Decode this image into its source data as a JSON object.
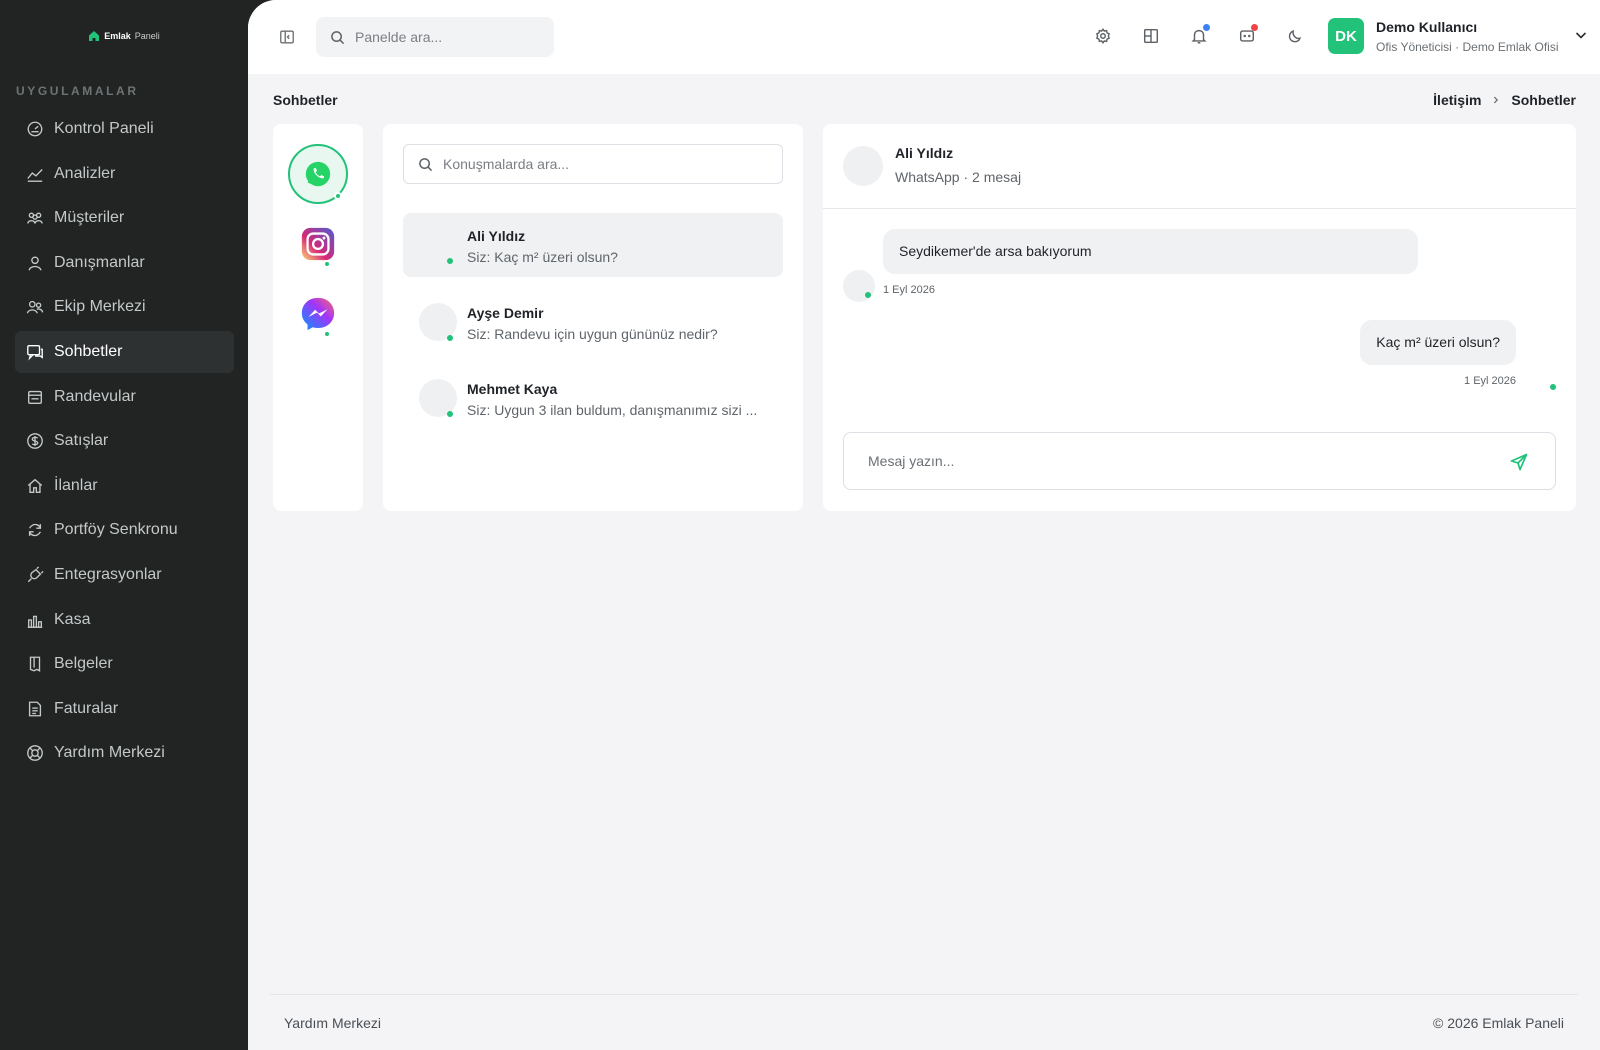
{
  "brand": {
    "name": "Emlak",
    "suffix": "Paneli"
  },
  "sidebar": {
    "section_label": "UYGULAMALAR",
    "items": [
      {
        "label": "Kontrol Paneli",
        "icon": "dashboard-icon"
      },
      {
        "label": "Analizler",
        "icon": "analytics-icon"
      },
      {
        "label": "Müşteriler",
        "icon": "customers-icon"
      },
      {
        "label": "Danışmanlar",
        "icon": "user-icon"
      },
      {
        "label": "Ekip Merkezi",
        "icon": "team-icon"
      },
      {
        "label": "Sohbetler",
        "icon": "chat-icon",
        "active": true
      },
      {
        "label": "Randevular",
        "icon": "calendar-icon"
      },
      {
        "label": "Satışlar",
        "icon": "dollar-icon"
      },
      {
        "label": "İlanlar",
        "icon": "home-icon"
      },
      {
        "label": "Portföy Senkronu",
        "icon": "sync-icon"
      },
      {
        "label": "Entegrasyonlar",
        "icon": "plug-icon"
      },
      {
        "label": "Kasa",
        "icon": "bar-chart-icon"
      },
      {
        "label": "Belgeler",
        "icon": "document-icon"
      },
      {
        "label": "Faturalar",
        "icon": "invoice-icon"
      },
      {
        "label": "Yardım Merkezi",
        "icon": "lifebuoy-icon"
      }
    ]
  },
  "topbar": {
    "search_placeholder": "Panelde ara...",
    "icons": [
      "settings-icon",
      "layout-icon",
      "bell-icon",
      "message-icon",
      "moon-icon"
    ],
    "user": {
      "initials": "DK",
      "name": "Demo Kullanıcı",
      "role": "Ofis Yöneticisi · Demo Emlak Ofisi"
    }
  },
  "page": {
    "title": "Sohbetler",
    "breadcrumb": [
      "İletişim",
      "Sohbetler"
    ]
  },
  "channels": [
    "whatsapp-icon",
    "instagram-icon",
    "messenger-icon"
  ],
  "conversations": {
    "search_placeholder": "Konuşmalarda ara...",
    "items": [
      {
        "name": "Ali Yıldız",
        "preview": "Siz: Kaç m² üzeri olsun?",
        "selected": true
      },
      {
        "name": "Ayşe Demir",
        "preview": "Siz: Randevu için uygun gününüz nedir?"
      },
      {
        "name": "Mehmet Kaya",
        "preview": "Siz: Uygun 3 ilan buldum, danışmanımız sizi ..."
      }
    ]
  },
  "chat": {
    "name": "Ali Yıldız",
    "subtitle": "WhatsApp · 2 mesaj",
    "messages": [
      {
        "direction": "in",
        "text": "Seydikemer'de arsa bakıyorum",
        "time": "1 Eyl 2026"
      },
      {
        "direction": "out",
        "text": "Kaç m² üzeri olsun?",
        "time": "1 Eyl 2026"
      }
    ],
    "composer_placeholder": "Mesaj yazın..."
  },
  "footer": {
    "left": "Yardım Merkezi",
    "right": "© 2026 Emlak Paneli"
  },
  "colors": {
    "accent": "#22c27a",
    "sidebar": "#222424",
    "page_bg": "#f4f4f6"
  }
}
